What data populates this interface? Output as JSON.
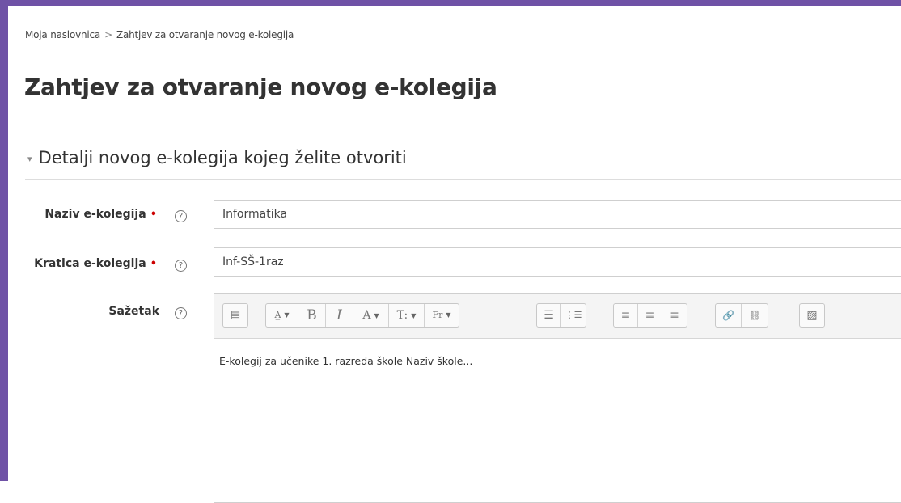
{
  "breadcrumb": {
    "home": "Moja naslovnica",
    "separator": ">",
    "current": "Zahtjev za otvaranje novog e-kolegija"
  },
  "page_title": "Zahtjev za otvaranje novog e-kolegija",
  "section": {
    "caret": "▾",
    "title": "Detalji novog e-kolegija kojeg želite otvoriti"
  },
  "form": {
    "required_mark": "•",
    "help_symbol": "?",
    "course_name": {
      "label": "Naziv e-kolegija",
      "value": "Informatika"
    },
    "course_short": {
      "label": "Kratica e-kolegija",
      "value": "Inf-SŠ-1raz"
    },
    "summary": {
      "label": "Sažetak",
      "value": "E-kolegij za učenike 1. razreda škole Naziv škole..."
    }
  },
  "toolbar": {
    "toggle": "▤",
    "style": "A̲",
    "bold": "B",
    "italic": "I",
    "font_color": "A",
    "font_size": "T:",
    "font_family": "Fr",
    "ul": "☰",
    "ol": "⋮☰",
    "align_left": "≡",
    "align_center": "≡",
    "align_right": "≡",
    "link": "🔗",
    "unlink": "⛓",
    "image": "▨",
    "dropdown": "▼"
  },
  "colors": {
    "frame": "#6f52a6",
    "required": "#cc0000"
  }
}
